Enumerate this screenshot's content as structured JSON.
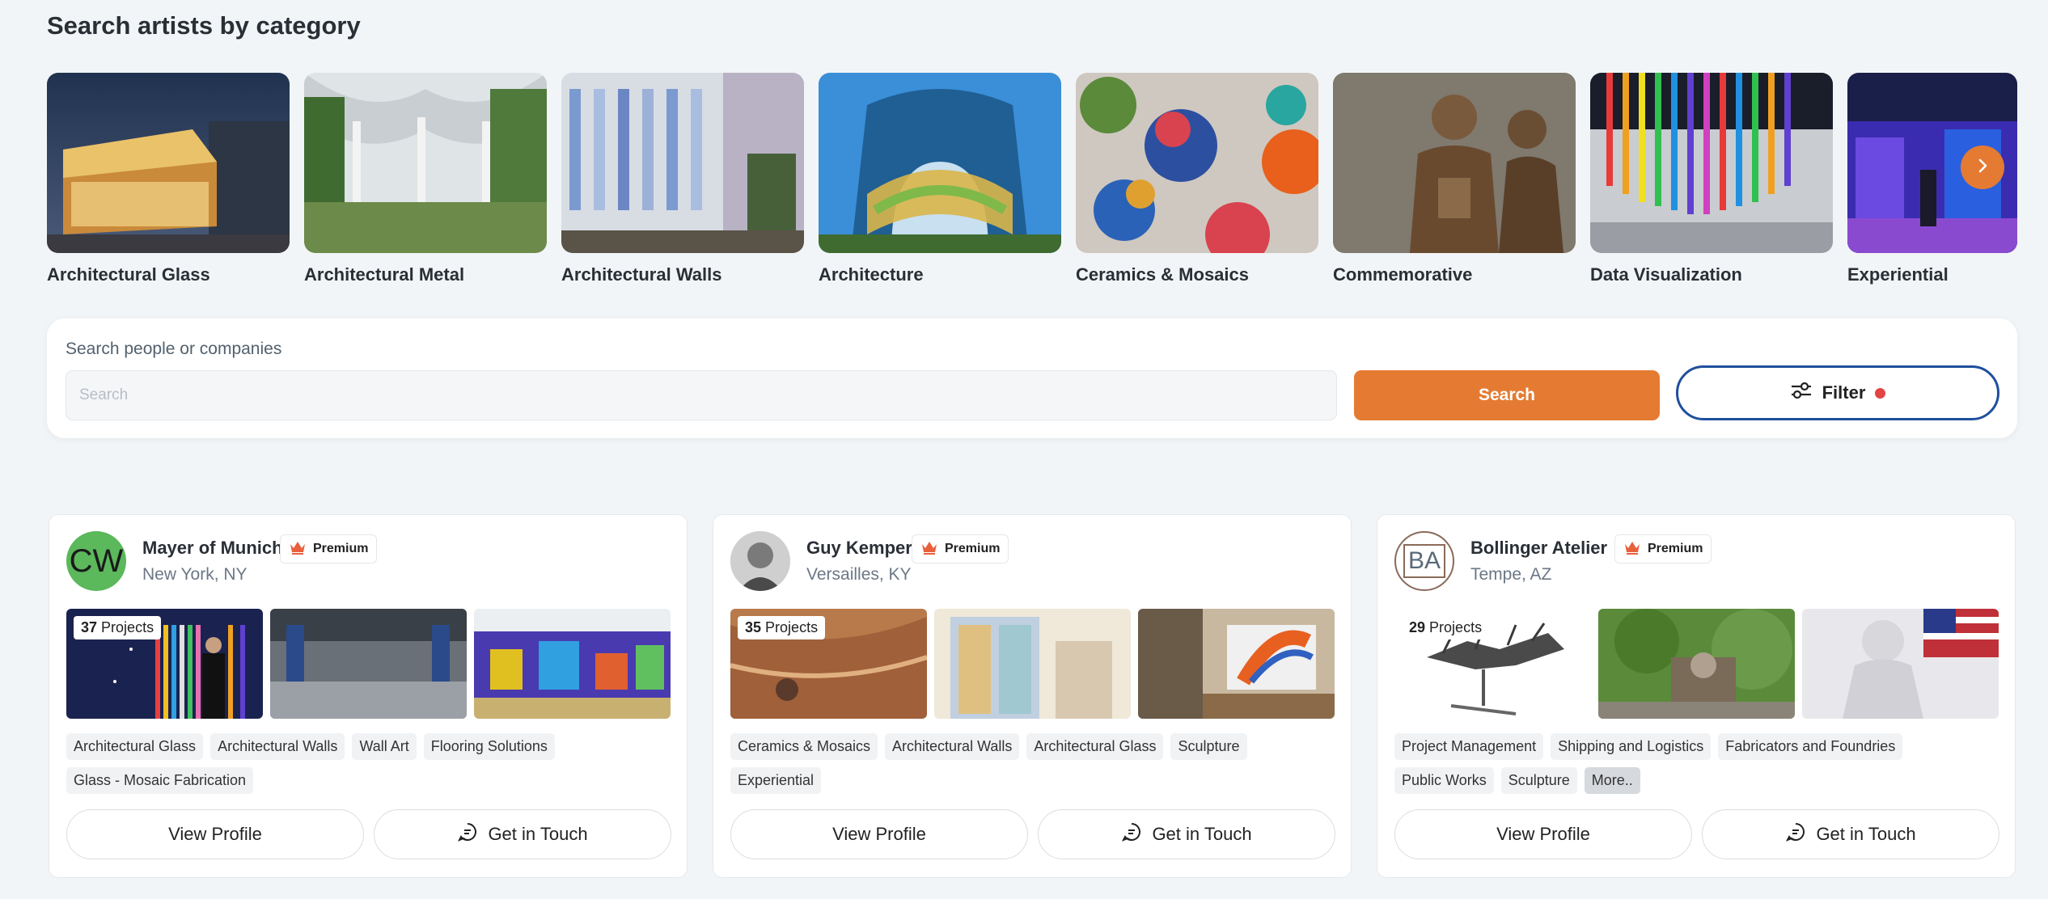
{
  "page": {
    "title": "Search artists by category"
  },
  "categories": [
    {
      "label": "Architectural Glass"
    },
    {
      "label": "Architectural Metal"
    },
    {
      "label": "Architectural Walls"
    },
    {
      "label": "Architecture"
    },
    {
      "label": "Ceramics & Mosaics"
    },
    {
      "label": "Commemorative"
    },
    {
      "label": "Data Visualization"
    },
    {
      "label": "Experiential"
    }
  ],
  "search": {
    "label": "Search people or companies",
    "placeholder": "Search",
    "value": "",
    "button_label": "Search",
    "filter_label": "Filter"
  },
  "colors": {
    "accent": "#e57b32",
    "filter_border": "#1f4f9e",
    "filter_dot": "#e34444"
  },
  "artists": [
    {
      "name": "Mayer of Munich",
      "premium_label": "Premium",
      "location": "New York, NY",
      "avatar_initials": "CW",
      "projects_count": "37",
      "projects_label": "Projects",
      "tags_row1": [
        "Architectural Glass",
        "Architectural Walls",
        "Wall Art",
        "Flooring Solutions"
      ],
      "tags_row2": [
        "Glass - Mosaic Fabrication"
      ],
      "view_profile": "View Profile",
      "get_in_touch": "Get in Touch"
    },
    {
      "name": "Guy Kemper",
      "premium_label": "Premium",
      "location": "Versailles, KY",
      "projects_count": "35",
      "projects_label": "Projects",
      "tags_row1": [
        "Ceramics & Mosaics",
        "Architectural Walls",
        "Architectural Glass",
        "Sculpture"
      ],
      "tags_row2": [
        "Experiential"
      ],
      "view_profile": "View Profile",
      "get_in_touch": "Get in Touch"
    },
    {
      "name": "Bollinger Atelier",
      "premium_label": "Premium",
      "location": "Tempe, AZ",
      "avatar_initials": "BA",
      "projects_count": "29",
      "projects_label": "Projects",
      "tags_row1": [
        "Project Management",
        "Shipping and Logistics",
        "Fabricators and Foundries"
      ],
      "tags_row2": [
        "Public Works",
        "Sculpture",
        "More.."
      ],
      "view_profile": "View Profile",
      "get_in_touch": "Get in Touch"
    }
  ]
}
